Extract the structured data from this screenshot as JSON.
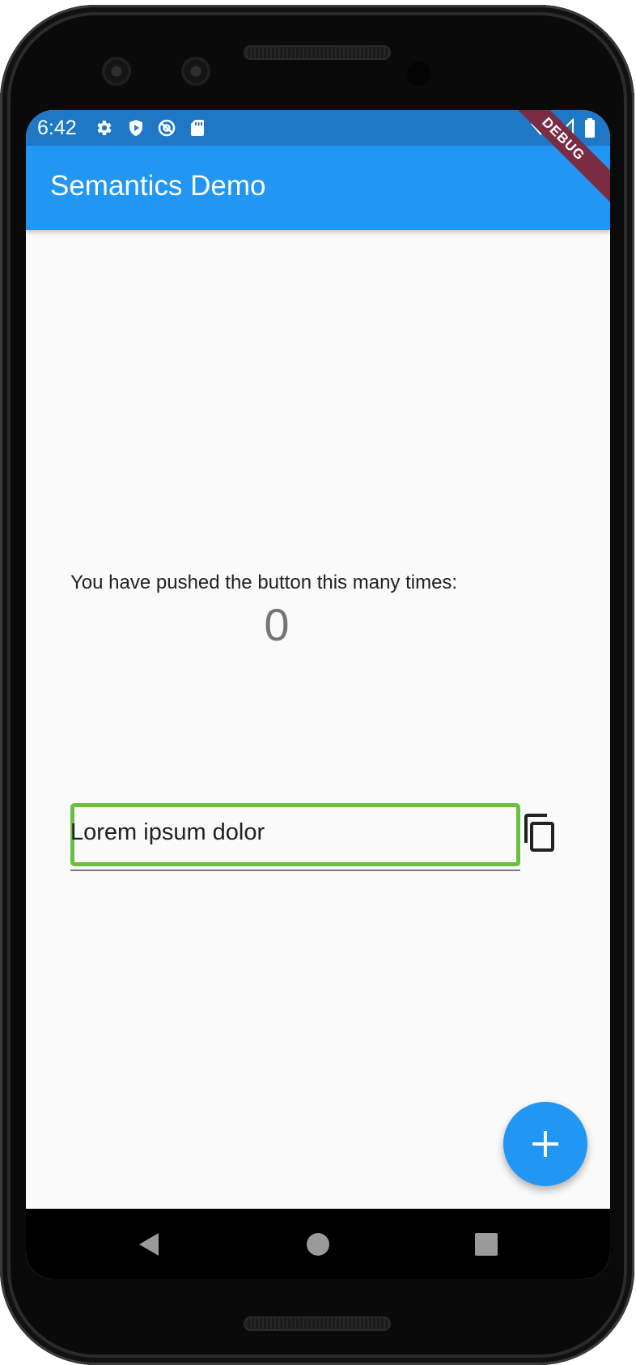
{
  "status_bar": {
    "time": "6:42",
    "left_icons": [
      "gear-icon",
      "shield-play-icon",
      "at-sign-icon",
      "sd-card-icon"
    ],
    "right_icons": [
      "wifi-icon",
      "signal-icon",
      "battery-icon"
    ],
    "color": "#1f78c6"
  },
  "app_bar": {
    "title": "Semantics Demo",
    "debug_label": "DEBUG",
    "color": "#2196f3"
  },
  "body": {
    "counter_text": "You have pushed the button this many times:",
    "counter_value": "0",
    "text_field_value": "Lorem ipsum dolor",
    "copy_icon": "copy-icon",
    "focus_color": "#6abf40"
  },
  "fab": {
    "icon": "plus-icon",
    "color": "#2196f3"
  },
  "navigation": {
    "buttons": [
      "back-icon",
      "home-icon",
      "recents-icon"
    ]
  }
}
